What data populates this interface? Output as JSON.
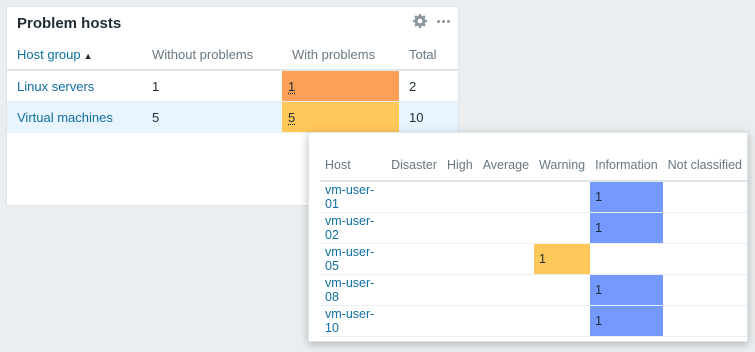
{
  "widget": {
    "title": "Problem hosts",
    "icons": [
      "gear-icon",
      "more-options-icon"
    ],
    "columns": [
      "Host group",
      "Without problems",
      "With problems",
      "Total"
    ],
    "sort_indicator": "▲",
    "rows": [
      {
        "group": "Linux servers",
        "without": "1",
        "with": "1",
        "total": "2",
        "severity": "average"
      },
      {
        "group": "Virtual machines",
        "without": "5",
        "with": "5",
        "total": "10",
        "severity": "warning"
      }
    ]
  },
  "popup": {
    "columns": [
      "Host",
      "Disaster",
      "High",
      "Average",
      "Warning",
      "Information",
      "Not classified"
    ],
    "rows": [
      {
        "host": "vm-user-01",
        "information": "1"
      },
      {
        "host": "vm-user-02",
        "information": "1"
      },
      {
        "host": "vm-user-05",
        "warning": "1"
      },
      {
        "host": "vm-user-08",
        "information": "1"
      },
      {
        "host": "vm-user-10",
        "information": "1"
      }
    ]
  },
  "colors": {
    "average": "#ffa059",
    "warning": "#ffc859",
    "information": "#7499ff",
    "link": "#0f6fa1",
    "highlight_row": "#e8f5ff"
  }
}
